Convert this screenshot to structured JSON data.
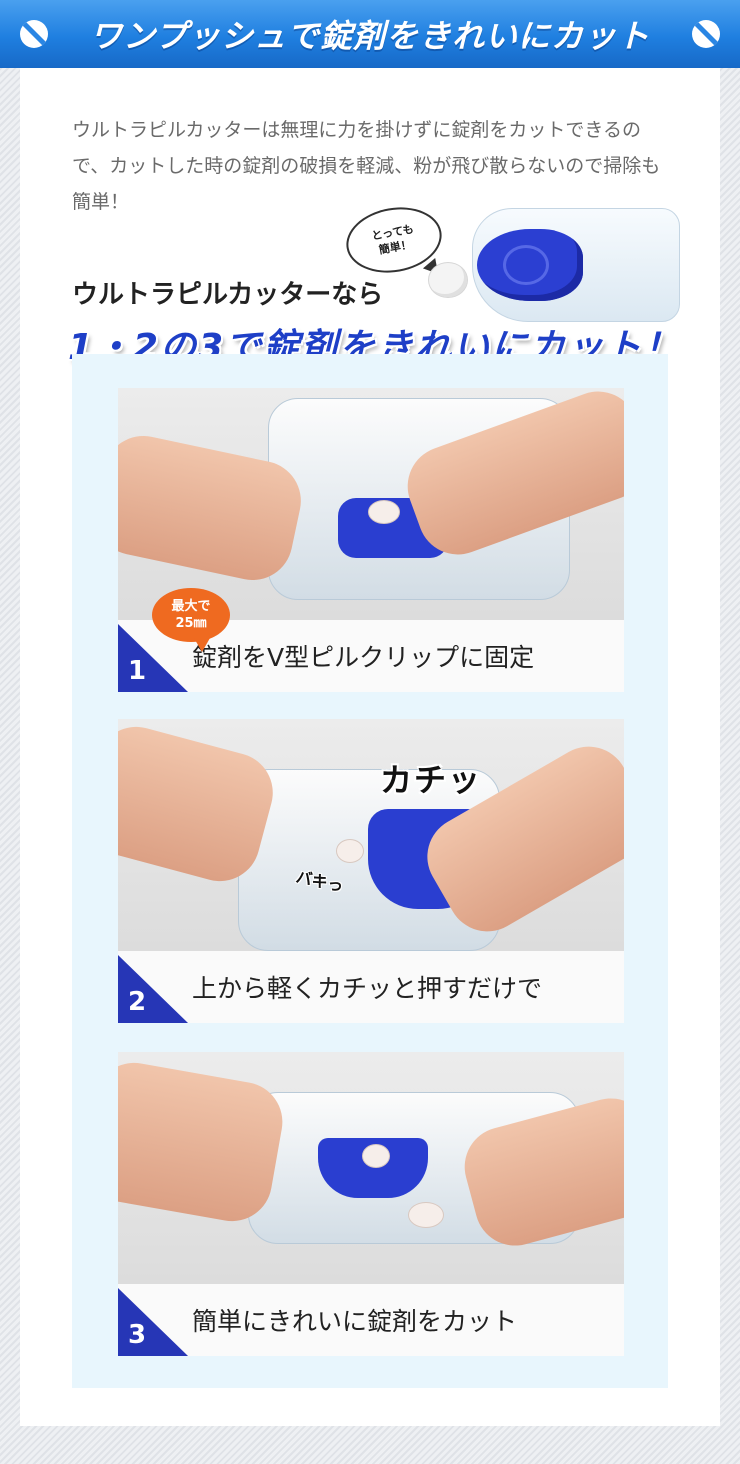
{
  "banner": {
    "title": "ワンプッシュで錠剤をきれいにカット"
  },
  "intro": "ウルトラピルカッターは無理に力を掛けずに錠剤をカットできるので、カットした時の錠剤の破損を軽減、粉が飛び散らないので掃除も簡単！",
  "bubble": {
    "line1": "とっても",
    "line2": "簡単！"
  },
  "subheading": "ウルトラピルカッターなら",
  "main_heading": "1・2の3で錠剤をきれいにカット！",
  "badge": {
    "line1": "最大で",
    "line2": "25㎜"
  },
  "sfx": {
    "click": "カチッ",
    "snap": "バキっ"
  },
  "steps": [
    {
      "number": "1",
      "caption": "錠剤をV型ピルクリップに固定"
    },
    {
      "number": "2",
      "caption": "上から軽くカチッと押すだけで"
    },
    {
      "number": "3",
      "caption": "簡単にきれいに錠剤をカット"
    }
  ],
  "colors": {
    "banner_blue": "#1f7fe0",
    "heading_blue": "#1e3fc7",
    "step_number_blue": "#2636b6",
    "badge_orange": "#ef6a20",
    "steps_box_bg": "#e8f6fd"
  }
}
